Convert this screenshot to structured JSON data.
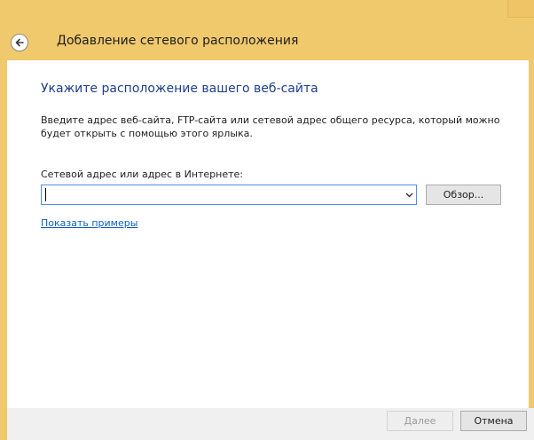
{
  "window": {
    "title": "Добавление сетевого расположения",
    "frame_color": "#f1c96d"
  },
  "header": {
    "back_icon": "back-arrow-icon"
  },
  "main": {
    "instruction": "Укажите расположение вашего веб-сайта",
    "description": "Введите адрес веб-сайта, FTP-сайта или сетевой адрес общего ресурса, который можно будет открыть с помощью этого ярлыка.",
    "address_label": "Сетевой адрес или адрес в Интернете:",
    "address_value": "",
    "browse_label": "Обзор...",
    "examples_link": "Показать примеры"
  },
  "footer": {
    "next_label": "Далее",
    "next_enabled": false,
    "cancel_label": "Отмена"
  },
  "colors": {
    "instruction_text": "#1e3f8a",
    "link": "#0f5fbf",
    "focus_border": "#4e8ee6"
  }
}
